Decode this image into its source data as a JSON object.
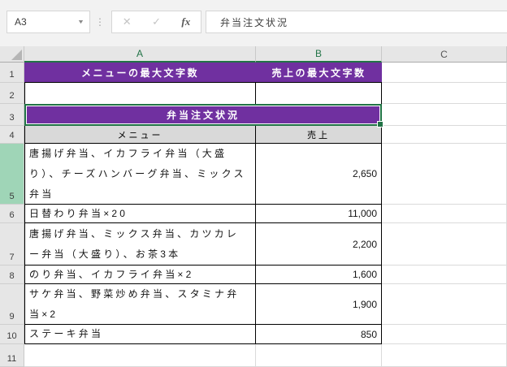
{
  "formula_bar": {
    "name_box_value": "A3",
    "formula_value": "弁当注文状況"
  },
  "icons": {
    "name_box_dropdown_glyph": "▼",
    "more_dots_glyph": "⋮",
    "cancel_glyph": "✕",
    "enter_glyph": "✓",
    "insert_function_glyph": "fx"
  },
  "column_headers": [
    "A",
    "B",
    "C"
  ],
  "selected_columns": [
    "A",
    "B"
  ],
  "selected_cell": "A3",
  "row_numbers": [
    "1",
    "2",
    "3",
    "4",
    "5",
    "6",
    "7",
    "8",
    "9",
    "10",
    "11"
  ],
  "cells": {
    "A1": "メニューの最大文字数",
    "B1": "売上の最大文字数",
    "A3": "弁当注文状況",
    "A4": "メニュー",
    "B4": "売上"
  },
  "table_rows": [
    {
      "row": "5",
      "menu": "唐揚げ弁当、イカフライ弁当（大盛り）、チーズハンバーグ弁当、ミックス弁当",
      "sales": "2,650"
    },
    {
      "row": "6",
      "menu": "日替わり弁当×20",
      "sales": "11,000"
    },
    {
      "row": "7",
      "menu": "唐揚げ弁当、ミックス弁当、カツカレー弁当（大盛り）、お茶3本",
      "sales": "2,200"
    },
    {
      "row": "8",
      "menu": "のり弁当、イカフライ弁当×2",
      "sales": "1,600"
    },
    {
      "row": "9",
      "menu": "サケ弁当、野菜炒め弁当、スタミナ弁当×2",
      "sales": "1,900"
    },
    {
      "row": "10",
      "menu": "ステーキ弁当",
      "sales": "850"
    }
  ],
  "colors": {
    "header_purple": "#7030A0",
    "table_header_gray": "#D9D9D9",
    "selection_green": "#217346",
    "selected_row_header_green": "#9FD5B7",
    "grid_header_gray": "#E6E6E6"
  }
}
